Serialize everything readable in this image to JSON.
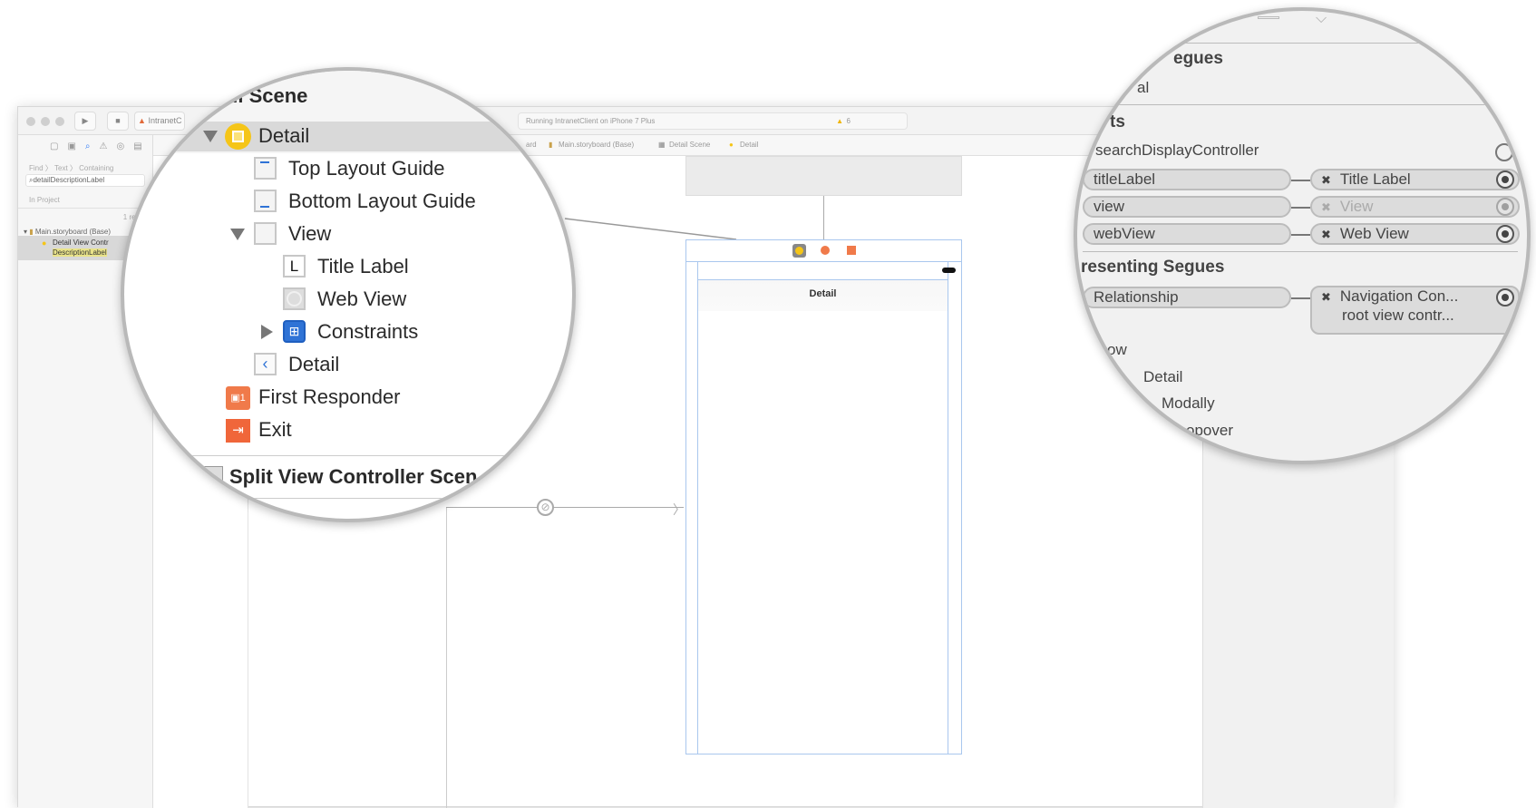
{
  "toolbar": {
    "scheme": "IntranetC",
    "activity": "Running IntranetClient on iPhone 7 Plus",
    "warnings": "6"
  },
  "jumpbar": {
    "items": [
      "ard",
      "Main.storyboard (Base)",
      "Detail Scene",
      "Detail"
    ]
  },
  "navigator": {
    "path": "Find 〉 Text 〉 Containing",
    "search_value": "detailDescriptionLabel",
    "scope": "In Project",
    "result_count": "1 result",
    "file": "Main.storyboard (Base)",
    "match_title": "Detail View Contr",
    "match_text": "DescriptionLabel"
  },
  "canvas": {
    "scene_title": "Detail"
  },
  "outline_zoom": {
    "scene_header": "ail Scene",
    "items": [
      {
        "label": "Detail",
        "icon": "view-controller-icon"
      },
      {
        "label": "Top Layout Guide",
        "icon": "top-layout-guide-icon"
      },
      {
        "label": "Bottom Layout Guide",
        "icon": "bottom-layout-guide-icon"
      },
      {
        "label": "View",
        "icon": "view-icon"
      },
      {
        "label": "Title Label",
        "icon": "label-icon",
        "glyph": "L"
      },
      {
        "label": "Web View",
        "icon": "web-view-icon"
      },
      {
        "label": "Constraints",
        "icon": "constraints-icon"
      },
      {
        "label": "Detail",
        "icon": "navigation-item-icon"
      },
      {
        "label": "First Responder",
        "icon": "first-responder-icon"
      },
      {
        "label": "Exit",
        "icon": "exit-icon"
      }
    ],
    "next_scene": "Split View Controller Scen"
  },
  "connections_zoom": {
    "triggered_heading": "egues",
    "manual": "al",
    "outlets_heading": "ts",
    "outlets": [
      {
        "name": "searchDisplayController",
        "target": ""
      },
      {
        "name": "titleLabel",
        "target": "Title Label"
      },
      {
        "name": "view",
        "target": "View"
      },
      {
        "name": "webView",
        "target": "Web View"
      }
    ],
    "presenting_heading": "resenting Segues",
    "relationship": {
      "name": "Relationship",
      "target_line1": "Navigation Con...",
      "target_line2": "root view contr..."
    },
    "segues": [
      "ow",
      "Detail",
      "Modally",
      "opover"
    ]
  },
  "colors": {
    "accent": "#f5c518",
    "exit": "#f0663a",
    "constraints": "#2f73d6",
    "selection": "#d9d9d9"
  }
}
